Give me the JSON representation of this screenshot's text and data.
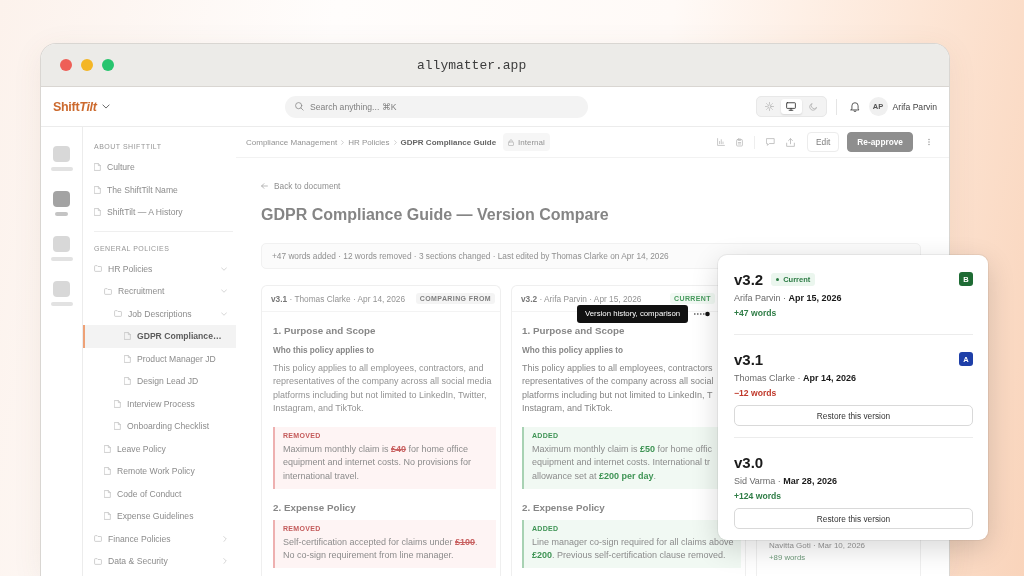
{
  "browser": {
    "url": "allymatter.app"
  },
  "header": {
    "logo": {
      "upright": "Shift",
      "italic": "Tilt"
    },
    "search": {
      "placeholder": "Search anything... ⌘K"
    },
    "theme_toggle": [
      {
        "kind": "sun",
        "selected": false
      },
      {
        "kind": "monitor",
        "selected": true
      },
      {
        "kind": "moon",
        "selected": false
      }
    ],
    "user": {
      "initials": "AP",
      "name": "Arifa Parvin"
    }
  },
  "nav_rail": [
    {
      "selected": false
    },
    {
      "selected": true
    },
    {
      "selected": false
    },
    {
      "selected": false
    }
  ],
  "sidebar": {
    "sections": [
      {
        "title": "ABOUT SHIFTTILT",
        "items": [
          {
            "kind": "page",
            "label": "Culture",
            "selected": false
          },
          {
            "kind": "page",
            "label": "The ShiftTilt Name",
            "selected": false
          },
          {
            "kind": "page",
            "label": "ShiftTilt — A History",
            "selected": false
          }
        ]
      },
      {
        "title": "GENERAL POLICIES",
        "items": [
          {
            "kind": "folder",
            "label": "HR Policies",
            "selected": false,
            "expanded": true,
            "children": [
              {
                "kind": "folder",
                "label": "Recruitment",
                "selected": false,
                "expanded": true,
                "children": [
                  {
                    "kind": "folder",
                    "label": "Job Descriptions",
                    "selected": false,
                    "expanded": true,
                    "children": [
                      {
                        "kind": "page",
                        "label": "GDPR Compliance…",
                        "selected": true
                      },
                      {
                        "kind": "page",
                        "label": "Product Manager JD",
                        "selected": false
                      },
                      {
                        "kind": "page",
                        "label": "Design Lead JD",
                        "selected": false
                      }
                    ]
                  },
                  {
                    "kind": "page",
                    "label": "Interview Process",
                    "selected": false
                  },
                  {
                    "kind": "page",
                    "label": "Onboarding Checklist",
                    "selected": false
                  }
                ]
              },
              {
                "kind": "page",
                "label": "Leave Policy",
                "selected": false
              },
              {
                "kind": "page",
                "label": "Remote Work Policy",
                "selected": false
              },
              {
                "kind": "page",
                "label": "Code of Conduct",
                "selected": false
              },
              {
                "kind": "page",
                "label": "Expense Guidelines",
                "selected": false
              }
            ]
          },
          {
            "kind": "folder",
            "label": "Finance Policies",
            "selected": false,
            "expanded": false
          },
          {
            "kind": "folder",
            "label": "Data & Security",
            "selected": false,
            "expanded": false
          }
        ]
      }
    ]
  },
  "toolbar": {
    "breadcrumbs": [
      "Compliance Management",
      "HR Policies",
      "GDPR Compliance Guide"
    ],
    "visibility": "Internal",
    "buttons": [
      {
        "kind": "secondary",
        "label": "Edit"
      },
      {
        "kind": "primary",
        "label": "Re-approve"
      }
    ]
  },
  "back_link": "Back to document",
  "title": "GDPR Compliance Guide — Version Compare",
  "summary": "+47 words added · 12 words removed · 3 sections changed · Last edited by Thomas Clarke on Apr 14, 2026",
  "columns": [
    {
      "kind": "from",
      "meta": "**v3.1** · Thomas Clarke · Apr 14, 2026",
      "badge": "COMPARING FROM",
      "sections": [
        {
          "heading": "1. Purpose and Scope",
          "subheading": "Who this policy applies to",
          "lines": [
            "This policy applies to all employees, contractors, and",
            "representatives of the company across all social media",
            "platforms including but not limited to LinkedIn, Twitter,",
            "Instagram, and TikTok."
          ],
          "change": {
            "kind": "removed",
            "label": "REMOVED",
            "lines": [
              "Maximum monthly claim is **£40** for home office",
              "equipment and internet costs. No provisions for",
              "international travel."
            ]
          }
        },
        {
          "heading": "2. Expense Policy",
          "change": {
            "kind": "removed",
            "label": "REMOVED",
            "lines": [
              "Self-certification accepted for claims under **£100**.",
              "No co-sign requirement from line manager."
            ]
          }
        }
      ]
    },
    {
      "kind": "current",
      "meta": "**v3.2** · Arifa Parvin · Apr 15, 2026",
      "badge": "CURRENT",
      "sections": [
        {
          "heading": "1. Purpose and Scope",
          "subheading": "Who this policy applies to",
          "lines": [
            "This policy applies to all employees, contractors",
            "representatives of the company across all social",
            "platforms including but not limited to LinkedIn, T",
            "Instagram, and TikTok."
          ],
          "change": {
            "kind": "added",
            "label": "ADDED",
            "lines": [
              "Maximum monthly claim is **£50** for home offic",
              "equipment and internet costs. International tr",
              "allowance set at **£200 per day**."
            ]
          }
        },
        {
          "heading": "2. Expense Policy",
          "change": {
            "kind": "added",
            "label": "ADDED",
            "lines": [
              "Line manager co-sign required for all claims above",
              "**£200**. Previous self-certification clause removed."
            ]
          }
        }
      ]
    }
  ],
  "history_panel": {
    "entries": [
      {
        "meta": "Navitta Goti · Mar 10, 2026",
        "change": {
          "kind": "added",
          "text": "+89 words"
        }
      }
    ]
  },
  "tooltip": "Version history, comparison",
  "popup": {
    "versions": [
      {
        "version": "v3.2",
        "tag": "Current",
        "badge": {
          "label": "B",
          "color": "#1e6b34"
        },
        "meta": "Arifa Parvin · **Apr 15, 2026**",
        "change": {
          "kind": "added",
          "text": "+47 words"
        }
      },
      {
        "version": "v3.1",
        "badge": {
          "label": "A",
          "color": "#1e3fa8"
        },
        "meta": "Thomas Clarke · **Apr 14, 2026**",
        "change": {
          "kind": "removed",
          "text": "−12 words"
        },
        "restore_button": "Restore this version"
      },
      {
        "version": "v3.0",
        "meta": "Sid Varma · **Mar 28, 2026**",
        "change": {
          "kind": "added",
          "text": "+124 words"
        },
        "restore_button": "Restore this version"
      }
    ]
  }
}
